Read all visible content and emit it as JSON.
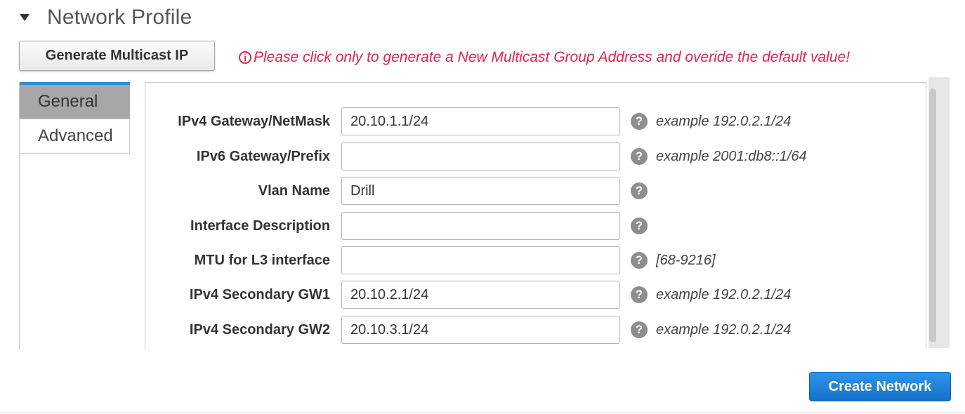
{
  "section": {
    "title": "Network Profile"
  },
  "toolbar": {
    "generate_label": "Generate Multicast IP",
    "warning_icon": "ⓘ",
    "warning_text": "Please click only to generate a New Multicast Group Address and overide the default value!"
  },
  "tabs": [
    {
      "label": "General",
      "active": true
    },
    {
      "label": "Advanced",
      "active": false
    }
  ],
  "fields": [
    {
      "label": "IPv4 Gateway/NetMask",
      "value": "20.10.1.1/24",
      "hint": "example 192.0.2.1/24"
    },
    {
      "label": "IPv6 Gateway/Prefix",
      "value": "",
      "hint": "example 2001:db8::1/64"
    },
    {
      "label": "Vlan Name",
      "value": "Drill",
      "hint": ""
    },
    {
      "label": "Interface Description",
      "value": "",
      "hint": ""
    },
    {
      "label": "MTU for L3 interface",
      "value": "",
      "hint": "[68-9216]"
    },
    {
      "label": "IPv4 Secondary GW1",
      "value": "20.10.2.1/24",
      "hint": "example 192.0.2.1/24"
    },
    {
      "label": "IPv4 Secondary GW2",
      "value": "20.10.3.1/24",
      "hint": "example 192.0.2.1/24"
    }
  ],
  "help_glyph": "?",
  "footer": {
    "create_label": "Create Network"
  },
  "colors": {
    "accent": "#1a7fd6",
    "warning": "#e0244e",
    "active_tab": "#a7a7a7"
  },
  "icons": {
    "collapse": "caret-down-icon",
    "warning": "info-circle-icon",
    "help": "question-circle-icon"
  }
}
